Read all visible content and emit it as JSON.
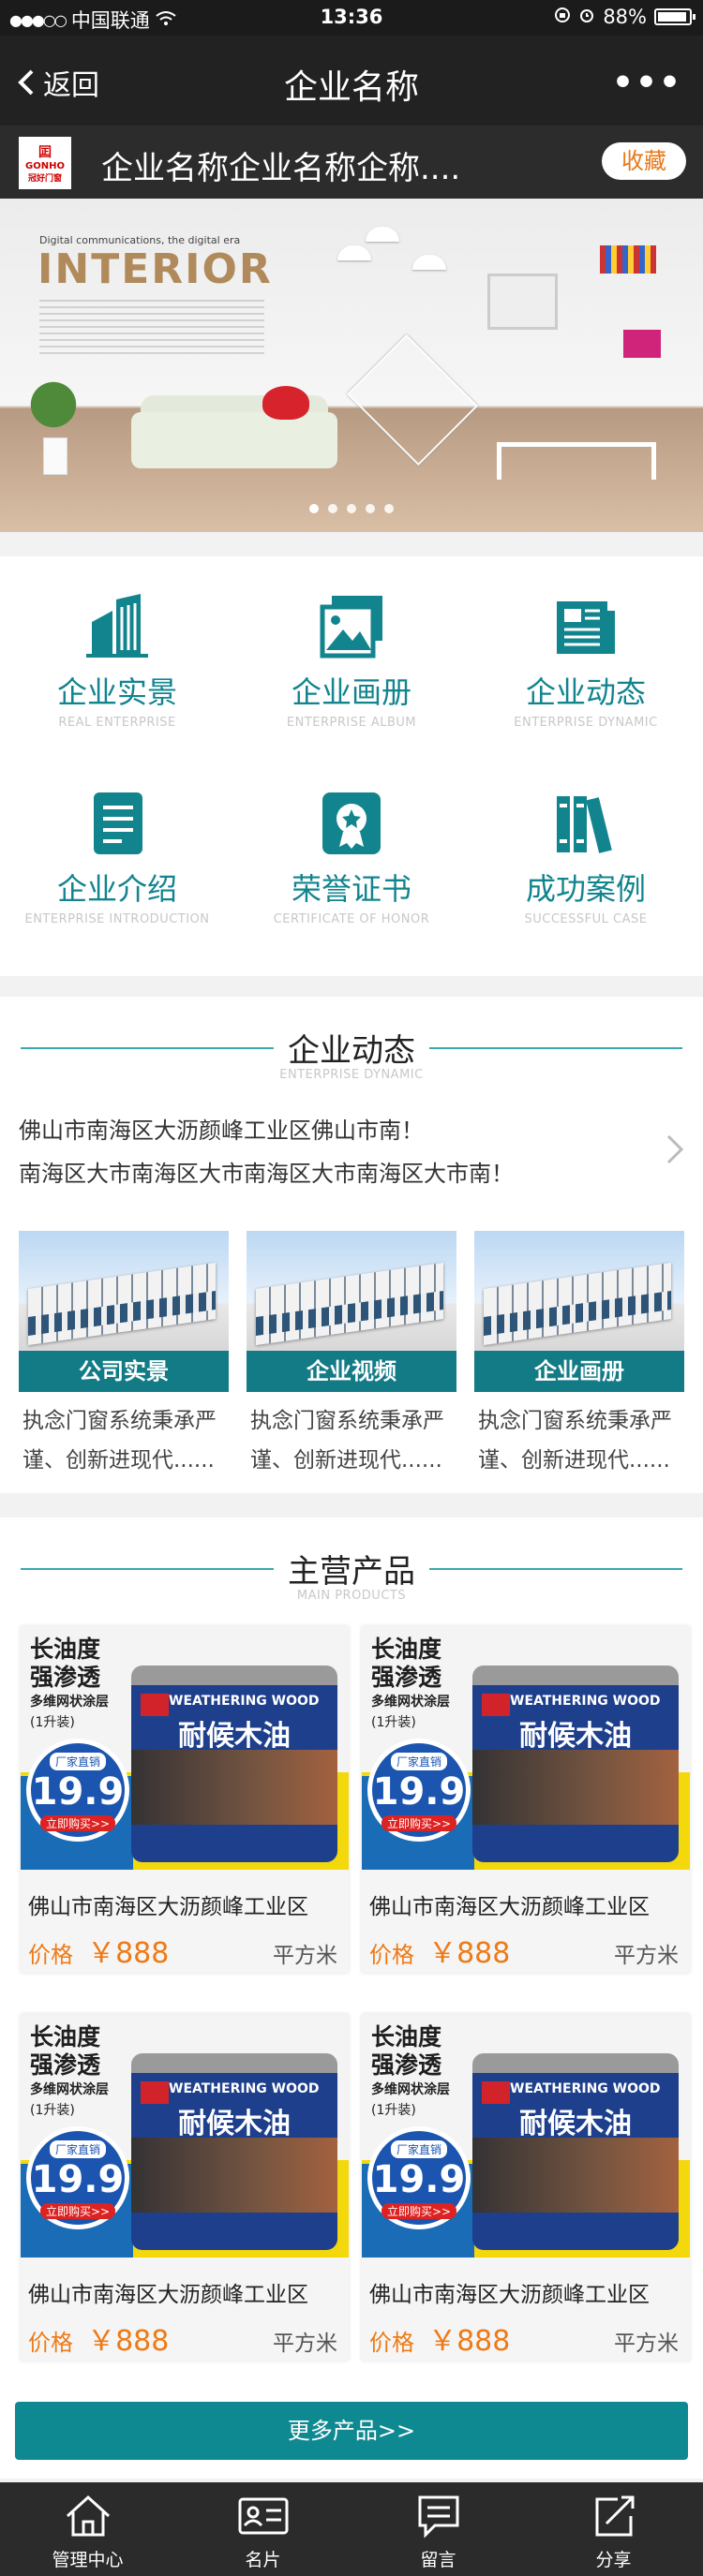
{
  "status_bar": {
    "carrier": "中国联通",
    "time": "13:36",
    "battery": "88%"
  },
  "nav": {
    "back_label": "返回",
    "title": "企业名称",
    "more": "•••"
  },
  "company": {
    "logo_brand": "GONHO",
    "logo_sub": "冠好门窗",
    "name": "企业名称企业名称企称....",
    "favorite_label": "收藏"
  },
  "banner": {
    "tagline": "Digital communications, the digital era",
    "headline": "INTERIOR",
    "slide_count": 5,
    "active_slide": 0
  },
  "grid": [
    {
      "title": "企业实景",
      "subtitle": "REAL ENTERPRISE",
      "icon": "building-icon"
    },
    {
      "title": "企业画册",
      "subtitle": "ENTERPRISE ALBUM",
      "icon": "album-icon"
    },
    {
      "title": "企业动态",
      "subtitle": "ENTERPRISE DYNAMIC",
      "icon": "news-icon"
    },
    {
      "title": "企业介绍",
      "subtitle": "ENTERPRISE INTRODUCTION",
      "icon": "document-icon"
    },
    {
      "title": "荣誉证书",
      "subtitle": "CERTIFICATE OF HONOR",
      "icon": "award-icon"
    },
    {
      "title": "成功案例",
      "subtitle": "SUCCESSFUL CASE",
      "icon": "books-icon"
    }
  ],
  "news": {
    "title": "企业动态",
    "subtitle": "ENTERPRISE DYNAMIC",
    "line1": "佛山市南海区大沥颜峰工业区佛山市南！",
    "line2": "南海区大市南海区大市南海区大市南海区大市南！",
    "cards": [
      {
        "label": "公司实景",
        "desc1": "执念门窗系统秉承严",
        "desc2": "谨、创新进现代......"
      },
      {
        "label": "企业视频",
        "desc1": "执念门窗系统秉承严",
        "desc2": "谨、创新进现代......"
      },
      {
        "label": "企业画册",
        "desc1": "执念门窗系统秉承严",
        "desc2": "谨、创新进现代......"
      }
    ]
  },
  "products": {
    "title": "主营产品",
    "subtitle": "MAIN PRODUCTS",
    "image": {
      "line1": "长油度",
      "line2": "强渗透",
      "line3": "多维网状涂层",
      "line4": "(1升装)",
      "promo": "厂家直销",
      "price_big": "19.9",
      "buy": "立即购买>>",
      "can_brand": "WEATHERING WOOD",
      "can_name": "耐候木油"
    },
    "items": [
      {
        "name": "佛山市南海区大沥颜峰工业区",
        "price_label": "价格",
        "price": "￥888",
        "unit": "平方米"
      },
      {
        "name": "佛山市南海区大沥颜峰工业区",
        "price_label": "价格",
        "price": "￥888",
        "unit": "平方米"
      },
      {
        "name": "佛山市南海区大沥颜峰工业区",
        "price_label": "价格",
        "price": "￥888",
        "unit": "平方米"
      },
      {
        "name": "佛山市南海区大沥颜峰工业区",
        "price_label": "价格",
        "price": "￥888",
        "unit": "平方米"
      }
    ],
    "more_label": "更多产品>>"
  },
  "tabbar": [
    {
      "label": "管理中心",
      "icon": "home-icon"
    },
    {
      "label": "名片",
      "icon": "id-card-icon"
    },
    {
      "label": "留言",
      "icon": "message-icon"
    },
    {
      "label": "分享",
      "icon": "share-icon"
    }
  ],
  "colors": {
    "accent": "#12848e",
    "price": "#ee7a16",
    "dark": "#222222"
  }
}
